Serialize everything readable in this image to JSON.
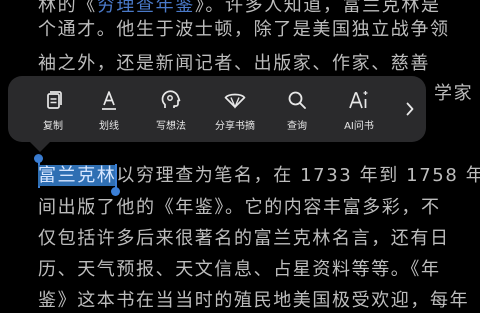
{
  "reader": {
    "lines": [
      "林的《穷理查年鉴》。许多人知道，富兰克林是",
      "个通才。他生于波士顿，除了是美国独立战争领",
      "袖之外，还是新闻记者、出版家、作家、慈善"
    ],
    "line_partial": "学家",
    "selected_text": "富兰克林",
    "line4_rest": "以穷理查为笔名，在 1733 年到 1758 年",
    "lines_after": [
      "间出版了他的《年鉴》。它的内容丰富多彩，不",
      "仅包括许多后来很著名的富兰克林名言，还有日",
      "历、天气预报、天文信息、占星资料等等。《年",
      "鉴》这本书在当当时的殖民地美国极受欢迎，每年"
    ],
    "title_link": "穷理查年鉴"
  },
  "toolbar": {
    "items": [
      {
        "label": "复制",
        "icon": "copy-icon"
      },
      {
        "label": "划线",
        "icon": "underline-icon"
      },
      {
        "label": "写想法",
        "icon": "thought-icon"
      },
      {
        "label": "分享书摘",
        "icon": "share-fan-icon"
      },
      {
        "label": "查询",
        "icon": "search-icon"
      },
      {
        "label": "AI问书",
        "icon": "ai-icon"
      }
    ],
    "more_icon": "chevron-right-icon"
  },
  "colors": {
    "background": "#000000",
    "text": "#bdbdbd",
    "selection": "#2f6fb3",
    "toolbar_bg": "#2a2a2c",
    "handle": "#3b7fd6"
  }
}
